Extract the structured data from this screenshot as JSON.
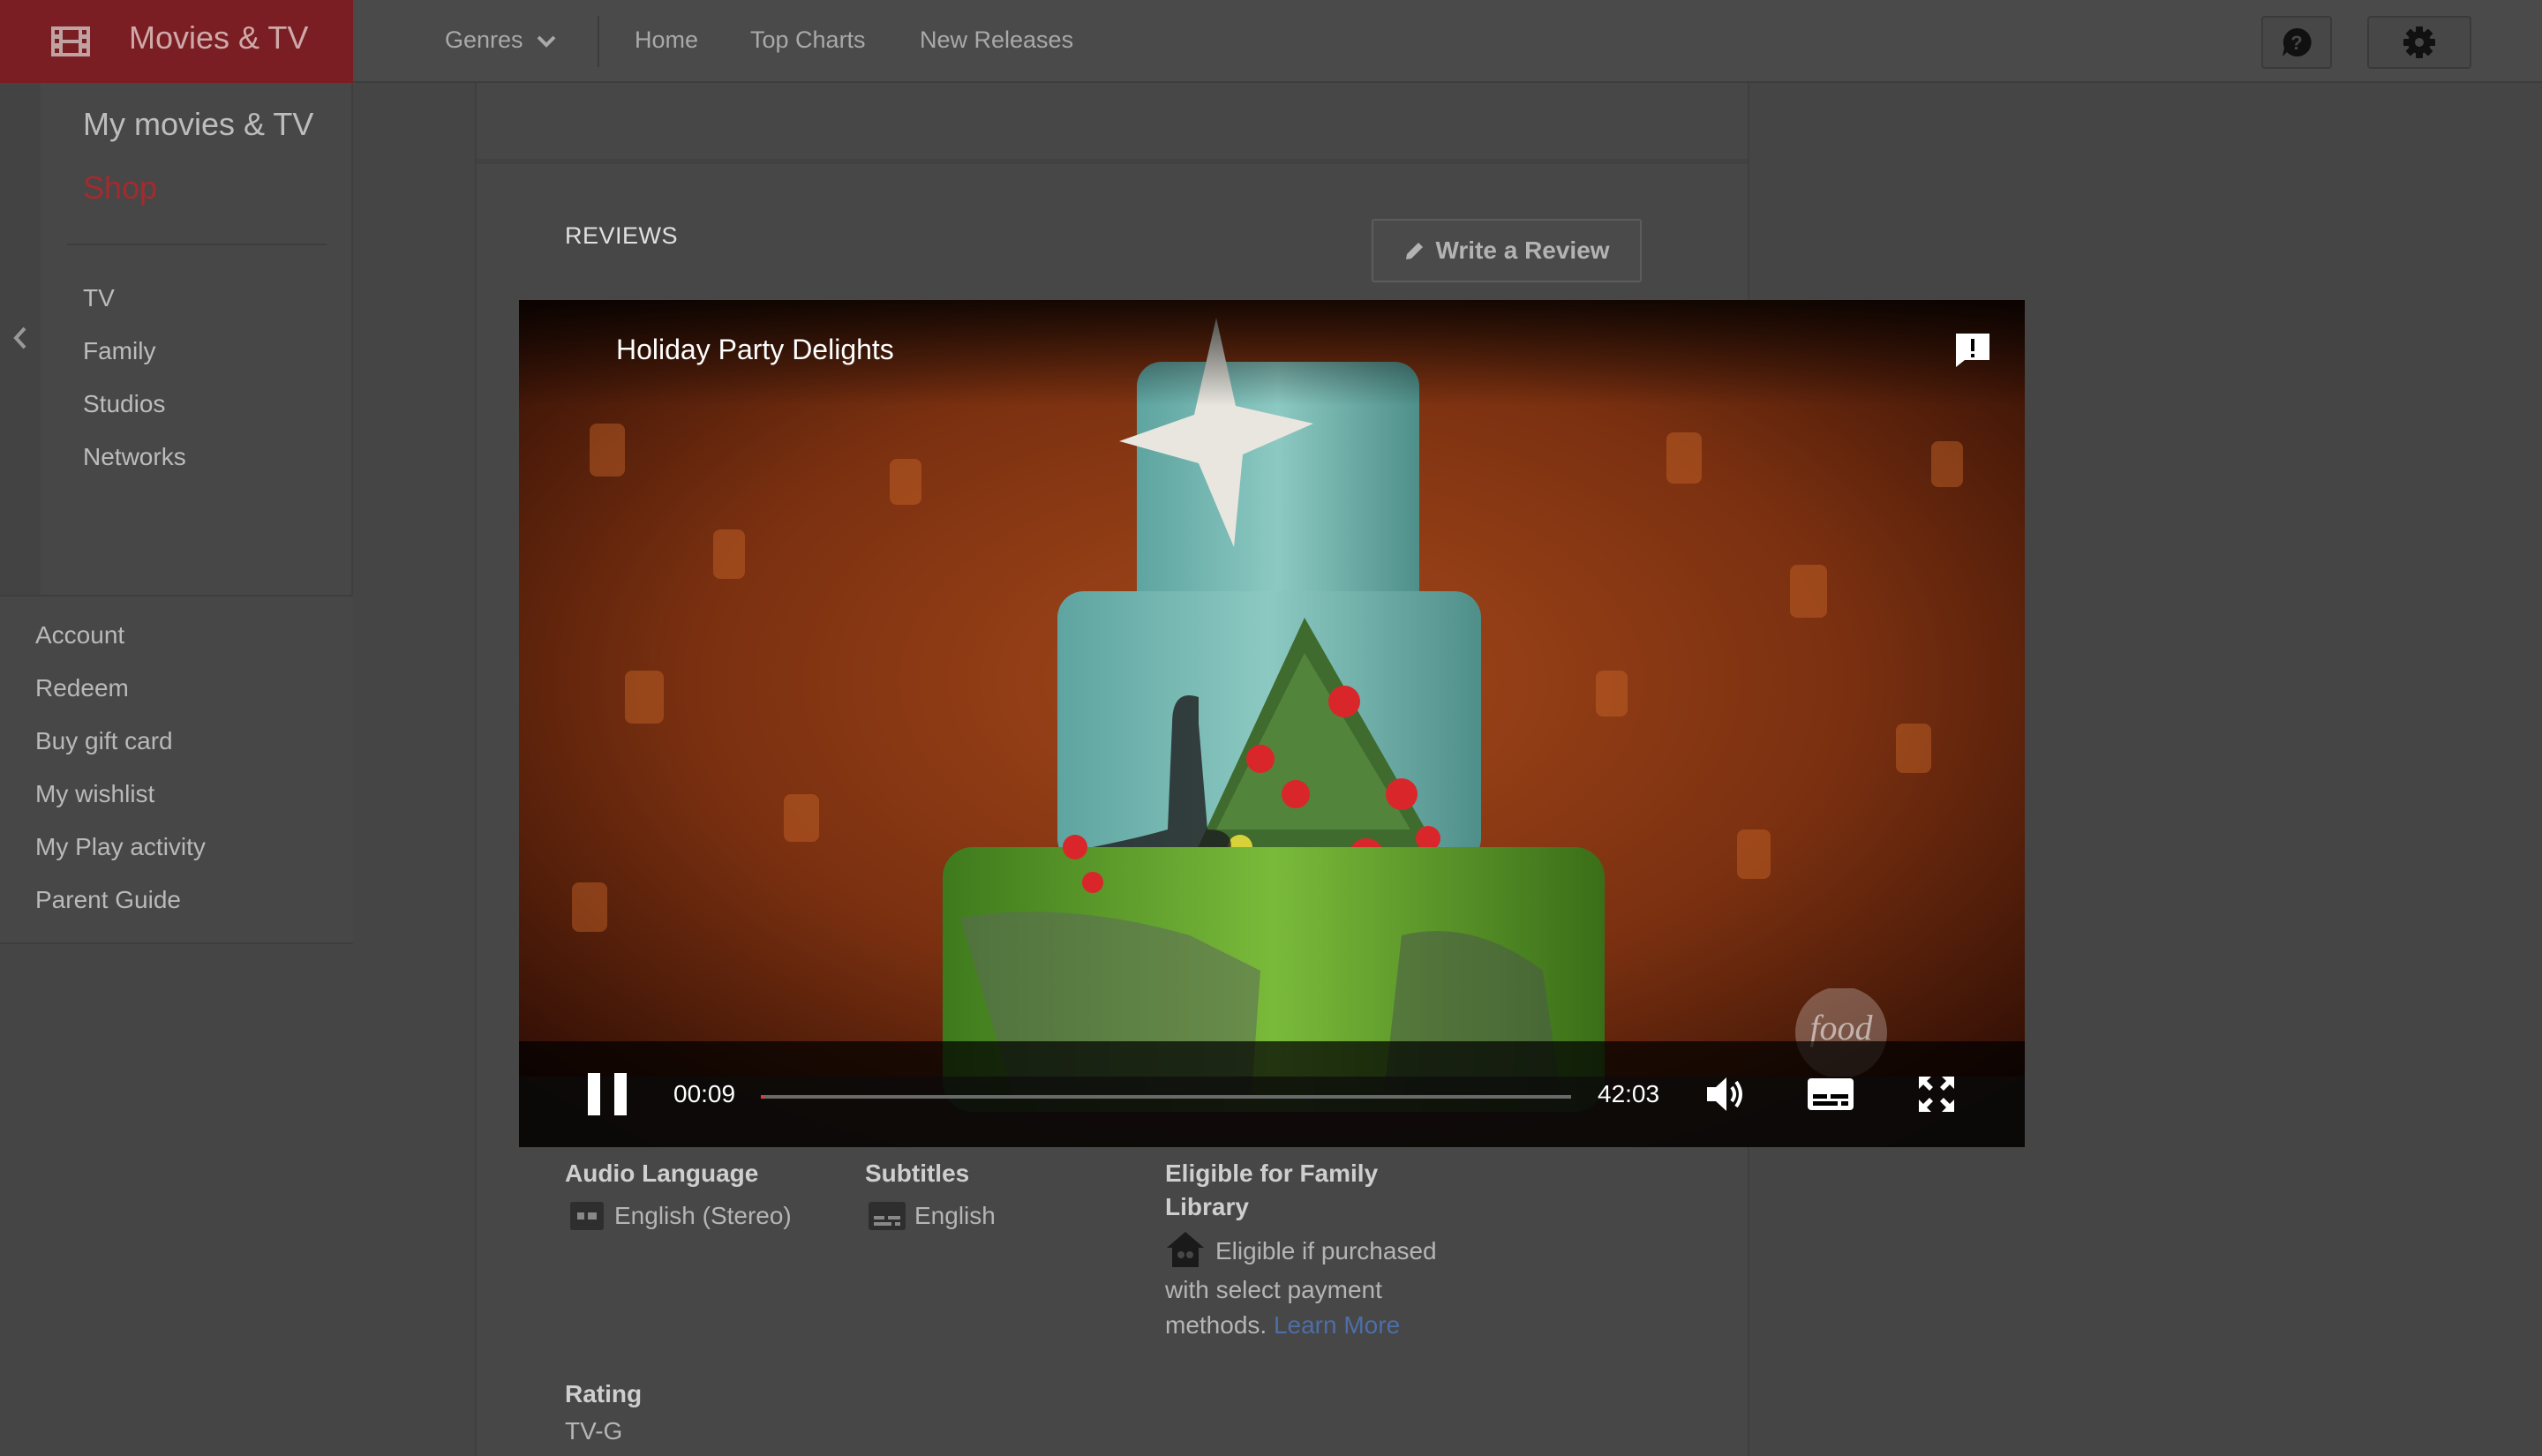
{
  "app": {
    "title": "Movies & TV",
    "brand_color": "#7a1e23"
  },
  "topnav": {
    "genres_label": "Genres",
    "items": [
      "Home",
      "Top Charts",
      "New Releases"
    ],
    "help_icon": "help-icon",
    "settings_icon": "gear-icon"
  },
  "sidebar": {
    "my_movies": "My movies & TV",
    "shop": "Shop",
    "shop_color": "#b2282c",
    "categories": [
      "TV",
      "Family",
      "Studios",
      "Networks"
    ],
    "account_items": [
      "Account",
      "Redeem",
      "Buy gift card",
      "My wishlist",
      "My Play activity",
      "Parent Guide"
    ]
  },
  "reviews": {
    "heading": "REVIEWS",
    "write_button": "Write a Review"
  },
  "player": {
    "title": "Holiday Party Delights",
    "current_time": "00:09",
    "total_time": "42:03",
    "progress": 0.004,
    "watermark": "food"
  },
  "details": {
    "audio": {
      "label": "Audio Language",
      "value": "English (Stereo)"
    },
    "subtitles": {
      "label": "Subtitles",
      "value": "English"
    },
    "family": {
      "label_line1": "Eligible for Family",
      "label_line2": "Library",
      "text_line1": "Eligible if purchased",
      "text_line2": "with select payment",
      "text_line3": "methods.",
      "link": "Learn More"
    },
    "rating": {
      "label": "Rating",
      "value": "TV-G"
    }
  }
}
